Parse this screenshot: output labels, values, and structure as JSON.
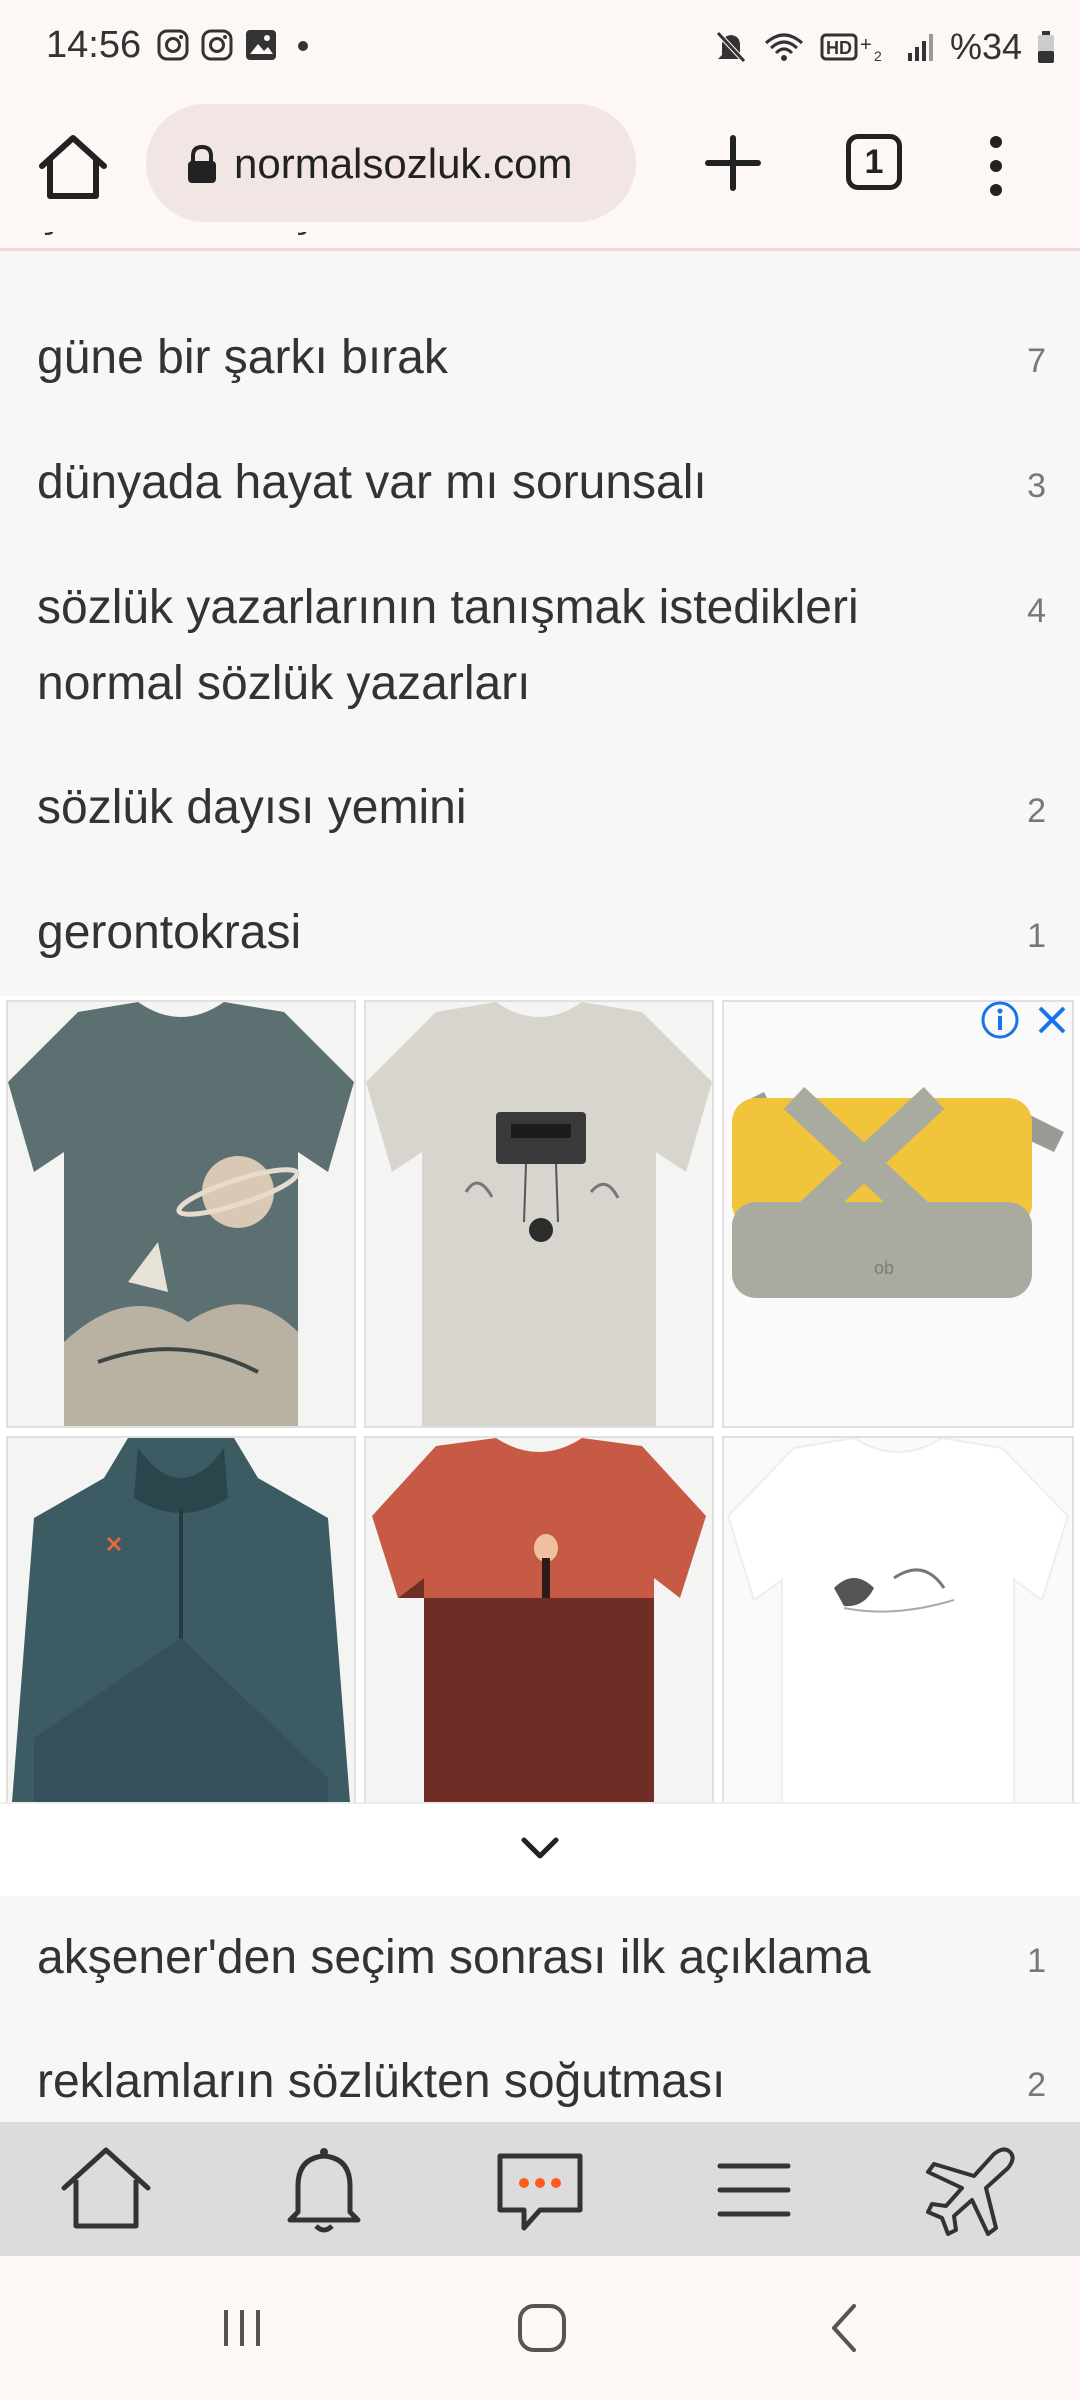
{
  "status_bar": {
    "time": "14:56",
    "battery": "%34"
  },
  "browser": {
    "url": "normalsozluk.com",
    "tab_count": "1"
  },
  "topics": [
    {
      "title": "güne bir şarkı bırak",
      "count": "7"
    },
    {
      "title": "dünyada hayat var mı sorunsalı",
      "count": "3"
    },
    {
      "title": "sözlük yazarlarının tanışmak istedikleri normal sözlük yazarları",
      "count": "4"
    },
    {
      "title": "sözlük dayısı yemini",
      "count": "2"
    },
    {
      "title": "gerontokrasi",
      "count": "1"
    },
    {
      "title": "akşener'den seçim sonrası ilk açıklama",
      "count": "1"
    },
    {
      "title": "reklamların sözlükten soğutması",
      "count": "2"
    }
  ],
  "ad": {
    "items": [
      {
        "kind": "tshirt-planet"
      },
      {
        "kind": "tshirt-cassette"
      },
      {
        "kind": "yellow-bag"
      },
      {
        "kind": "teal-jacket"
      },
      {
        "kind": "red-tshirt"
      },
      {
        "kind": "white-tshirt"
      }
    ]
  },
  "site_nav": {
    "icons": [
      "home-icon",
      "bell-icon",
      "chat-icon",
      "hamburger-icon",
      "airplane-icon"
    ],
    "accent": "#ff5a1f"
  },
  "colors": {
    "url_pill": "#f1e6e4",
    "header_bg": "#fdf7f6",
    "nav_bg": "#dcdcdc",
    "info_blue": "#1a73e8"
  }
}
